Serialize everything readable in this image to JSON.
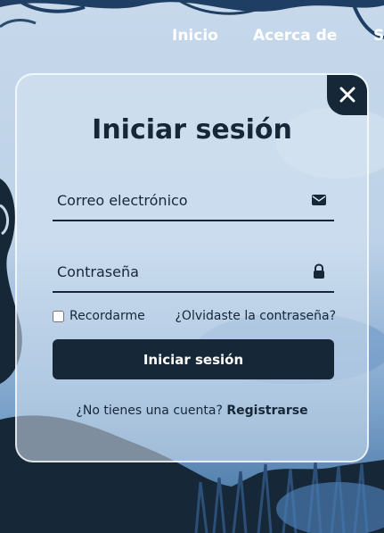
{
  "nav": {
    "items": [
      {
        "label": "Inicio"
      },
      {
        "label": "Acerca de"
      },
      {
        "label": "Se"
      }
    ]
  },
  "login": {
    "title": "Iniciar sesión",
    "email_placeholder": "Correo electrónico",
    "password_placeholder": "Contraseña",
    "remember_label": "Recordarme",
    "remember_checked": false,
    "forgot_label": "¿Olvidaste la contraseña?",
    "submit_label": "Iniciar sesión",
    "no_account_text": "¿No tienes una cuenta?",
    "register_label": "Registrarse"
  },
  "icons": {
    "close": "close-icon",
    "email": "envelope-icon",
    "password": "lock-icon"
  },
  "colors": {
    "primary": "#162738",
    "button_text": "#ffffff",
    "card_border": "#ffffff"
  }
}
